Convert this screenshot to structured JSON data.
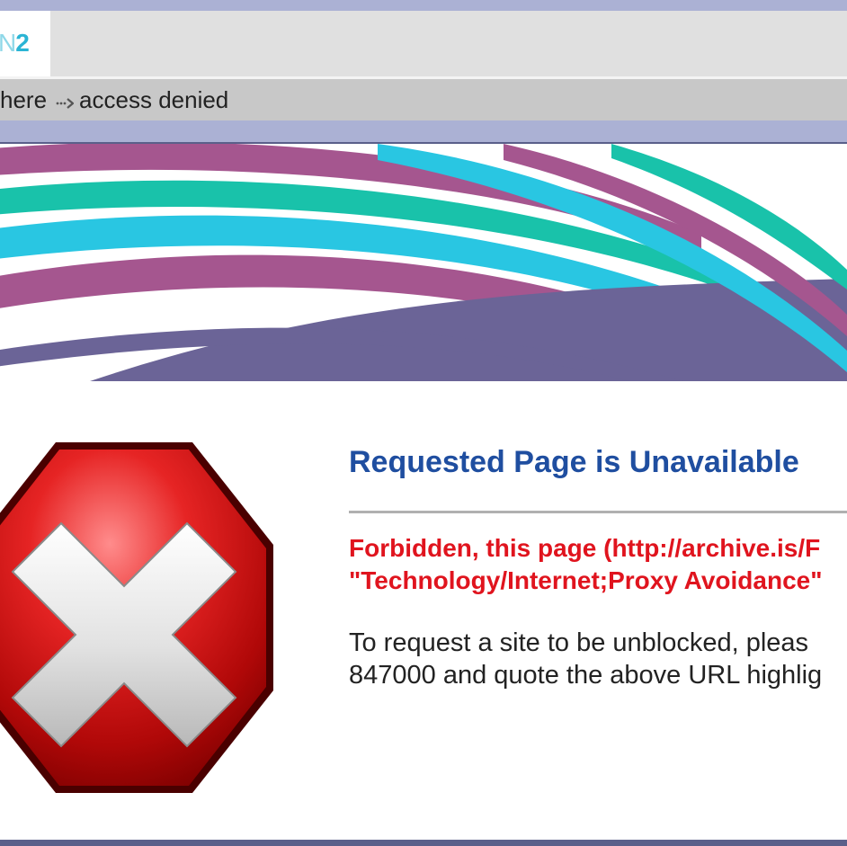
{
  "header": {
    "logo_text_n": "N",
    "logo_text_2": "2"
  },
  "breadcrumb": {
    "items": [
      {
        "label": "here"
      },
      {
        "label": "access denied"
      }
    ],
    "separator_icon": "double-arrow-right-icon"
  },
  "main": {
    "icon": "stop-error-icon",
    "title": "Requested Page is Unavailable",
    "error_line_1": "Forbidden, this page (http://archive.is/F",
    "error_line_2": "\"Technology/Internet;Proxy Avoidance\"",
    "info_line_1": "To request a site to be unblocked, pleas",
    "info_line_2": "847000 and quote the above URL highlig"
  },
  "colors": {
    "title": "#1f4ea0",
    "error": "#e0141e",
    "header_strip": "#abb1d4",
    "breadcrumb_bg": "#c8c8c8",
    "banner_purple": "#a5568f",
    "banner_teal": "#19c2aa",
    "banner_cyan": "#29c6e2",
    "banner_slate": "#6b6497"
  }
}
